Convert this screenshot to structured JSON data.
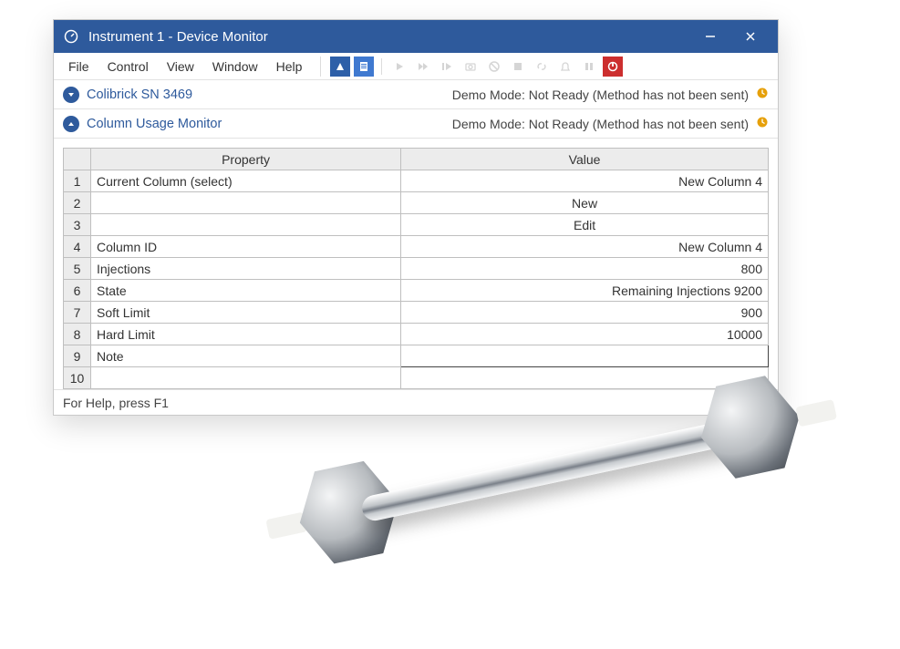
{
  "window": {
    "title": "Instrument 1 - Device Monitor"
  },
  "menu": {
    "file": "File",
    "control": "Control",
    "view": "View",
    "window": "Window",
    "help": "Help"
  },
  "panels": {
    "p1": {
      "name": "Colibrick SN 3469",
      "status": "Demo Mode: Not Ready (Method has not been sent)"
    },
    "p2": {
      "name": "Column Usage Monitor",
      "status": "Demo Mode: Not Ready (Method has not been sent)"
    }
  },
  "grid": {
    "headers": {
      "rownum": "",
      "property": "Property",
      "value": "Value"
    },
    "rows": [
      {
        "n": "1",
        "property": "Current Column (select)",
        "value": "New Column 4",
        "align": "right"
      },
      {
        "n": "2",
        "property": "",
        "value": "New",
        "type": "button"
      },
      {
        "n": "3",
        "property": "",
        "value": "Edit",
        "type": "button"
      },
      {
        "n": "4",
        "property": "Column ID",
        "value": "New Column 4",
        "align": "right"
      },
      {
        "n": "5",
        "property": "Injections",
        "value": "800",
        "align": "right"
      },
      {
        "n": "6",
        "property": "State",
        "value": "Remaining Injections 9200",
        "align": "right"
      },
      {
        "n": "7",
        "property": "Soft Limit",
        "value": "900",
        "align": "right"
      },
      {
        "n": "8",
        "property": "Hard Limit",
        "value": "10000",
        "align": "right"
      },
      {
        "n": "9",
        "property": "Note",
        "value": "",
        "type": "input"
      },
      {
        "n": "10",
        "property": "",
        "value": ""
      }
    ]
  },
  "statusbar": {
    "hint": "For Help, press F1"
  },
  "colors": {
    "accent": "#2e5a9c",
    "warning": "#e6a00a",
    "danger": "#cc2e2e"
  }
}
